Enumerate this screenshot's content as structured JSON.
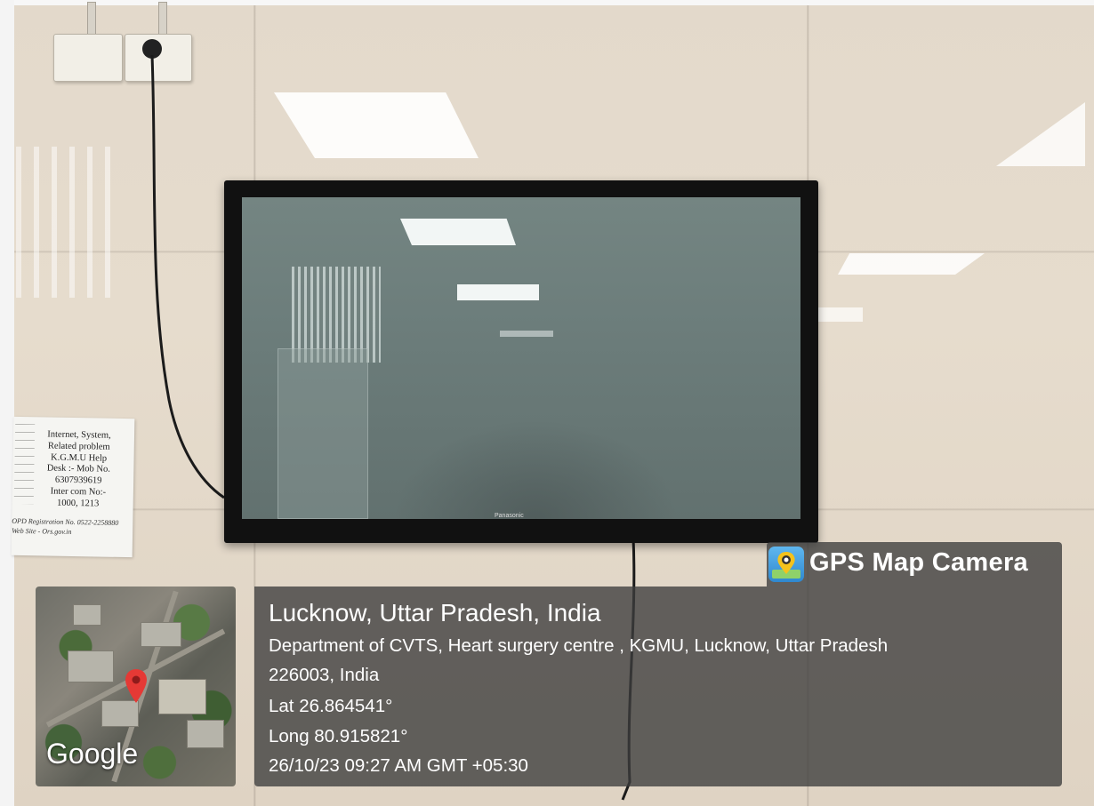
{
  "overlay": {
    "app_name": "GPS Map Camera",
    "location_title": "Lucknow, Uttar Pradesh, India",
    "address_line1": "Department of CVTS, Heart surgery centre , KGMU, Lucknow, Uttar Pradesh",
    "address_line2": "226003, India",
    "latitude": "Lat 26.864541°",
    "longitude": "Long 80.915821°",
    "datetime": "26/10/23 09:27 AM GMT +05:30",
    "map_label": "Google",
    "app_icon": "map-pin-icon",
    "pin_icon": "map-marker-icon"
  },
  "notice": {
    "lines": [
      "Internet, System,",
      "Related problem",
      "K.G.M.U Help",
      "Desk :- Mob No.",
      "6307939619",
      "Inter com No:-",
      "1000, 1213"
    ],
    "hand_line1": "OPD Registration No. 0522-2258880",
    "hand_line2": "Web Site - Ors.gov.in"
  },
  "tv": {
    "brand": "Panasonic"
  }
}
